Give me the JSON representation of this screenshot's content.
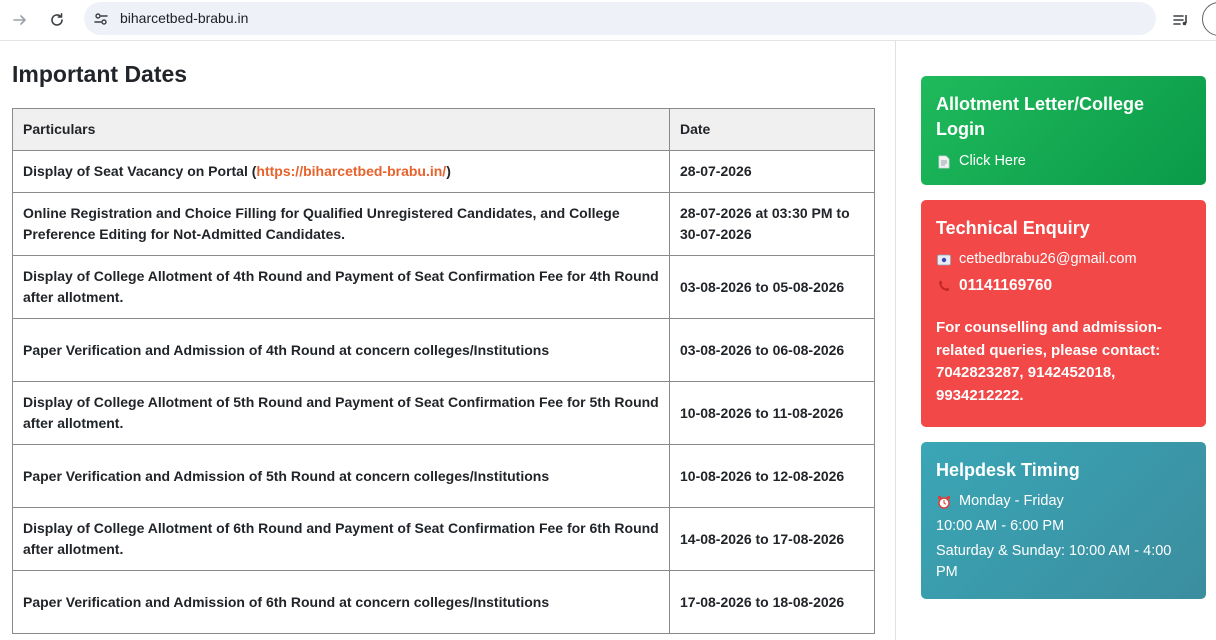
{
  "browser": {
    "url": "biharcetbed-brabu.in"
  },
  "page": {
    "title": "Important Dates"
  },
  "table": {
    "headers": [
      "Particulars",
      "Date"
    ],
    "rows": [
      {
        "particulars_pre": "Display of Seat Vacancy on Portal (",
        "link": "https://biharcetbed-brabu.in/",
        "particulars_post": ")",
        "date": "28-07-2026"
      },
      {
        "particulars": "Online Registration and Choice Filling for Qualified Unregistered Candidates, and College Preference Editing for Not-Admitted Candidates.",
        "date": "28-07-2026 at 03:30 PM to 30-07-2026"
      },
      {
        "particulars": "Display of College Allotment of 4th Round and Payment of Seat Confirmation Fee for 4th Round after allotment.",
        "date": "03-08-2026 to 05-08-2026"
      },
      {
        "particulars": "Paper Verification and Admission of 4th Round at concern colleges/Institutions",
        "date": "03-08-2026 to 06-08-2026"
      },
      {
        "particulars": "Display of College Allotment of 5th Round and Payment of Seat Confirmation Fee for 5th Round after allotment.",
        "date": "10-08-2026 to 11-08-2026"
      },
      {
        "particulars": "Paper Verification and Admission of 5th Round at concern colleges/Institutions",
        "date": "10-08-2026 to 12-08-2026"
      },
      {
        "particulars": "Display of College Allotment of 6th Round and Payment of Seat Confirmation Fee for 6th Round after allotment.",
        "date": "14-08-2026 to 17-08-2026"
      },
      {
        "particulars": "Paper Verification and Admission of 6th Round at concern colleges/Institutions",
        "date": "17-08-2026 to 18-08-2026"
      }
    ]
  },
  "sidebar": {
    "allotment": {
      "title": "Allotment Letter/College Login",
      "link_label": "Click Here",
      "icon": "document-icon",
      "color": "#12a852"
    },
    "enquiry": {
      "title": "Technical Enquiry",
      "email": "cetbedbrabu26@gmail.com",
      "phone": "01141169760",
      "note": "For counselling and admission-related queries, please contact: 7042823287, 9142452018, 9934212222.",
      "email_icon": "email-icon",
      "phone_icon": "phone-icon",
      "color": "#f24848"
    },
    "helpdesk": {
      "title": "Helpdesk Timing",
      "weekdays": "Monday - Friday",
      "weekday_hours": "10:00 AM - 6:00 PM",
      "weekend": "Saturday & Sunday: 10:00 AM - 4:00 PM",
      "icon": "alarm-clock-icon",
      "color": "#3a9aab"
    }
  }
}
